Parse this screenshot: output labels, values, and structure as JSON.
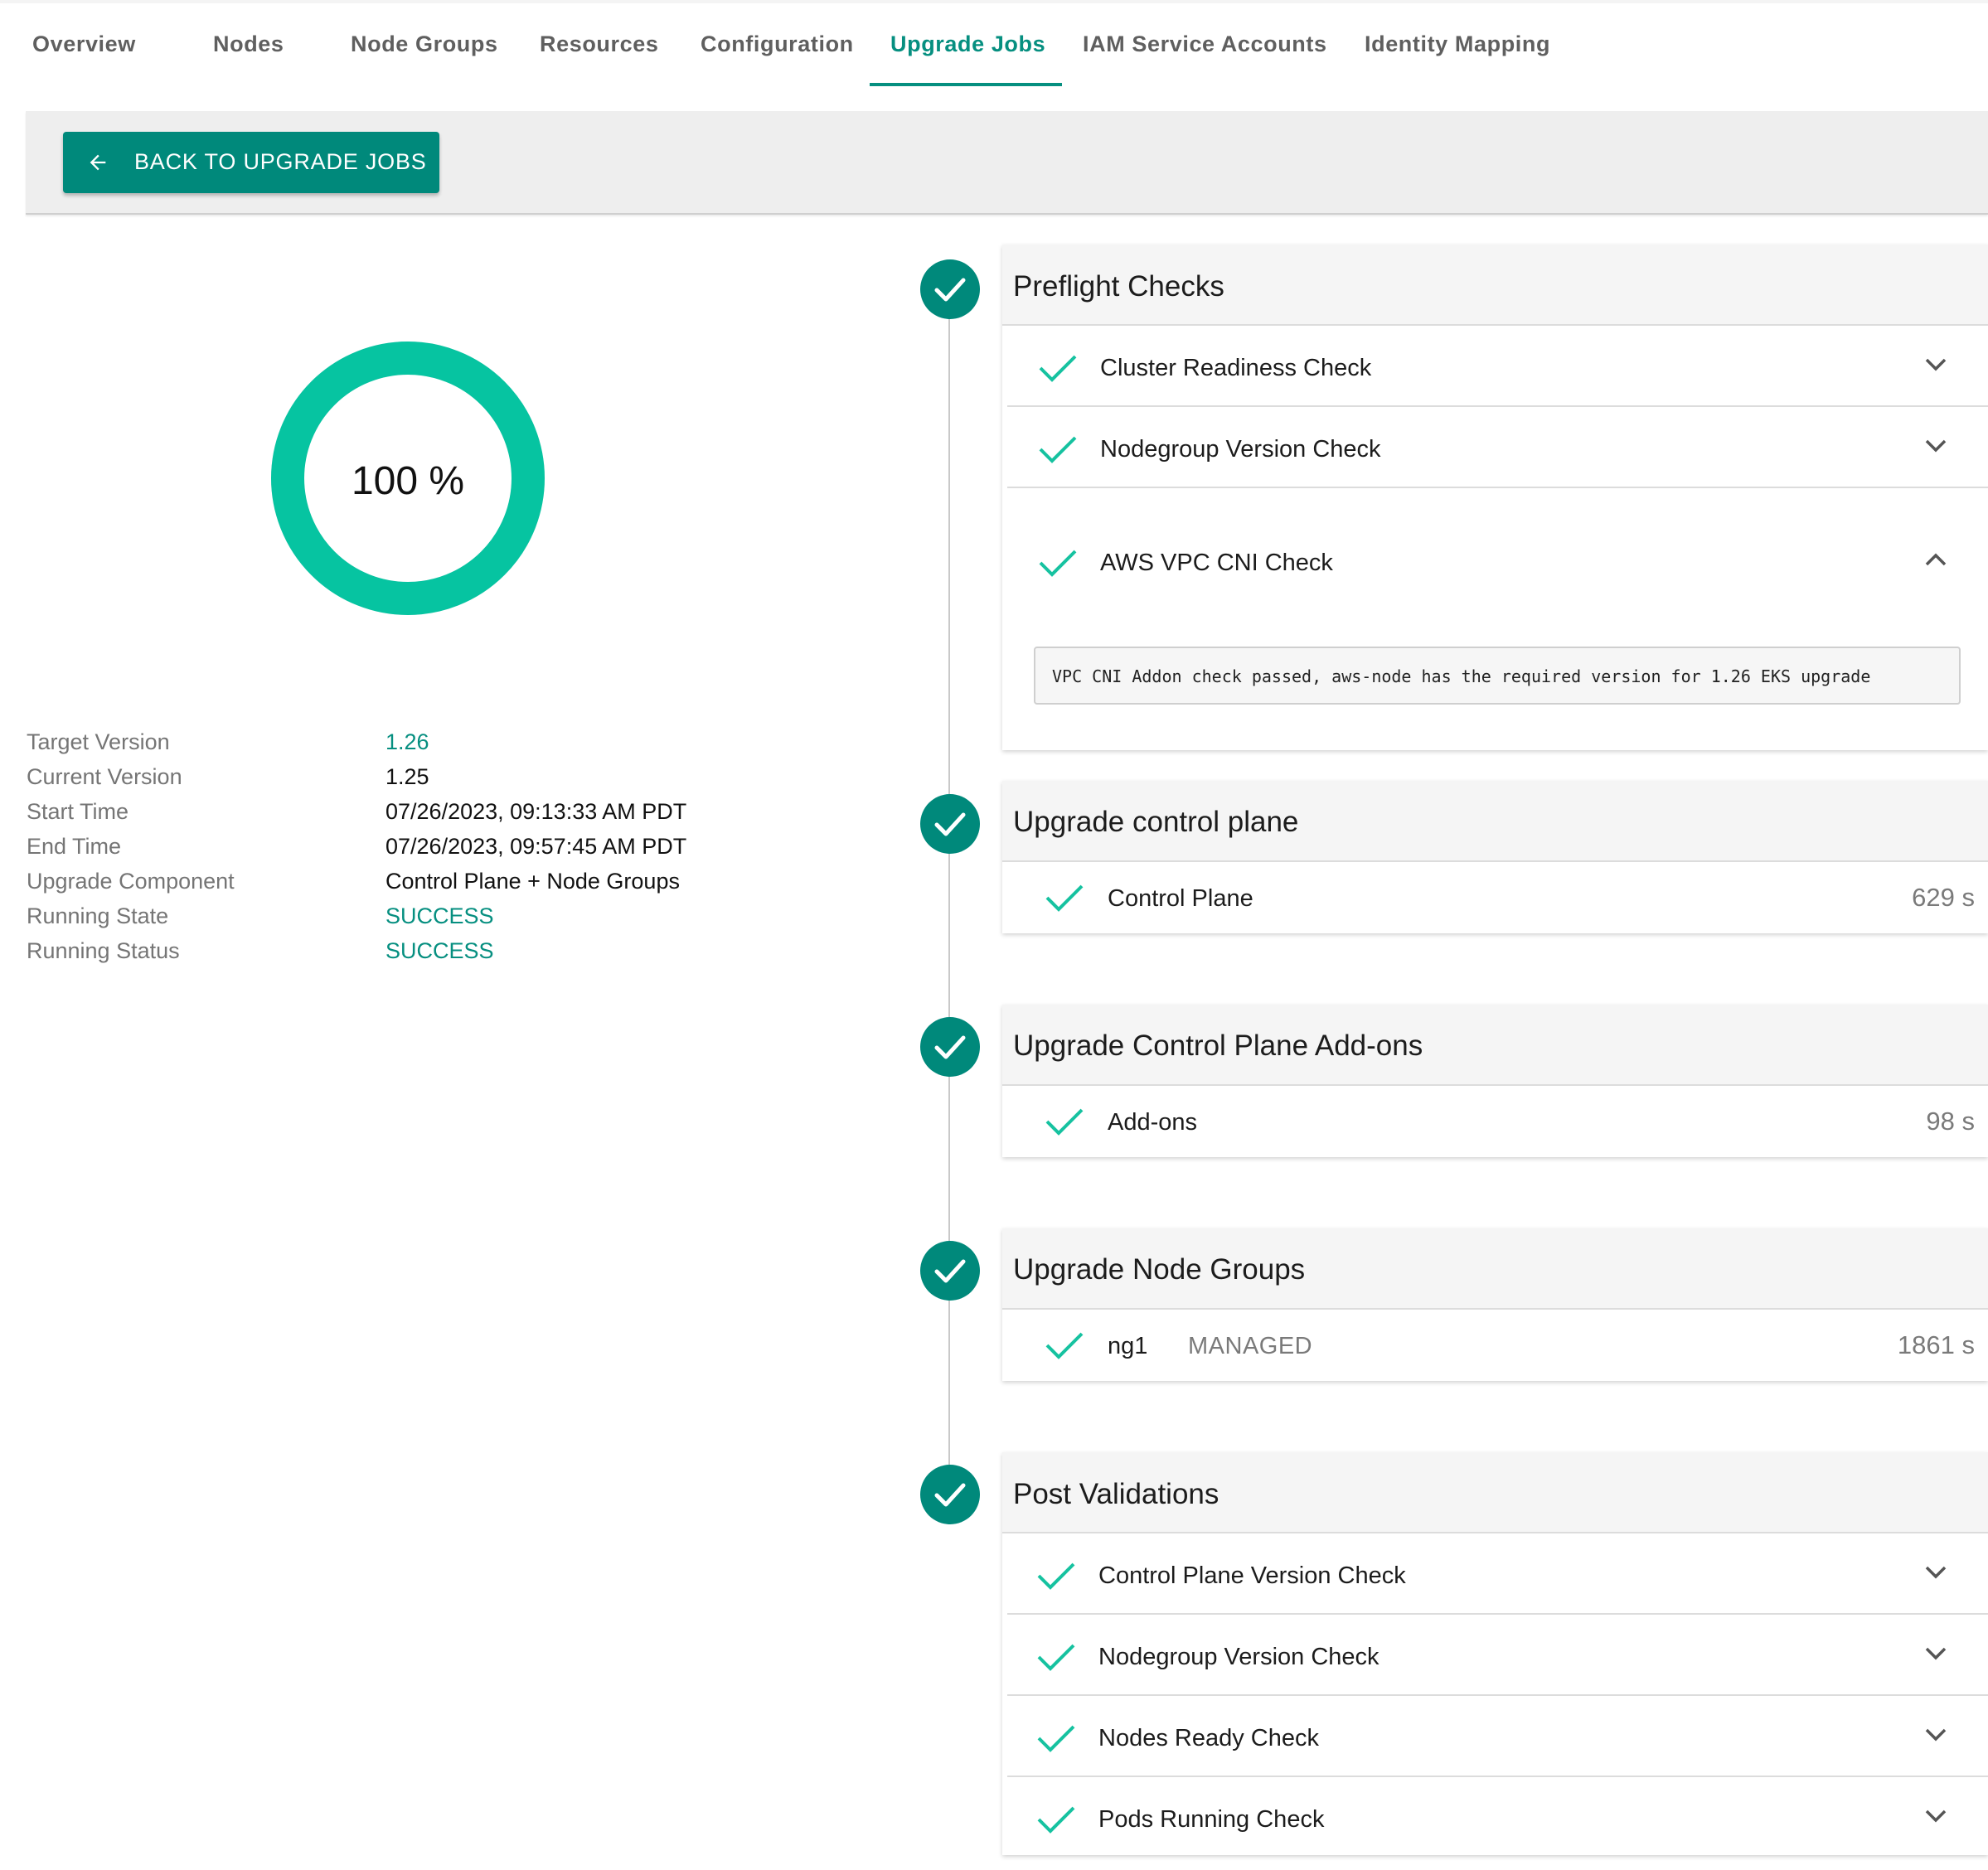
{
  "tabs": [
    {
      "label": "Overview"
    },
    {
      "label": "Nodes"
    },
    {
      "label": "Node Groups"
    },
    {
      "label": "Resources"
    },
    {
      "label": "Configuration"
    },
    {
      "label": "Upgrade Jobs",
      "active": true
    },
    {
      "label": "IAM Service Accounts"
    },
    {
      "label": "Identity Mapping"
    }
  ],
  "toolbar": {
    "back_label": "BACK TO UPGRADE JOBS"
  },
  "progress": {
    "percent": 100,
    "label": "100 %"
  },
  "info": [
    {
      "label": "Target Version",
      "value": "1.26"
    },
    {
      "label": "Current Version",
      "value": "1.25"
    },
    {
      "label": "Start Time",
      "value": "07/26/2023, 09:13:33 AM PDT"
    },
    {
      "label": "End Time",
      "value": "07/26/2023, 09:57:45 AM PDT"
    },
    {
      "label": "Upgrade Component",
      "value": "Control Plane + Node Groups"
    },
    {
      "label": "Running State",
      "value": "SUCCESS"
    },
    {
      "label": "Running Status",
      "value": "SUCCESS"
    }
  ],
  "steps": {
    "preflight": {
      "title": "Preflight Checks",
      "checks": [
        {
          "label": "Cluster Readiness Check"
        },
        {
          "label": "Nodegroup Version Check"
        },
        {
          "label": "AWS VPC CNI Check",
          "detail": "VPC CNI Addon check passed, aws-node has the required version for 1.26 EKS upgrade"
        }
      ]
    },
    "control_plane": {
      "title": "Upgrade control plane",
      "task": {
        "label": "Control Plane",
        "duration": "629 s"
      }
    },
    "addons": {
      "title": "Upgrade Control Plane Add-ons",
      "task": {
        "label": "Add-ons",
        "duration": "98 s"
      }
    },
    "node_groups": {
      "title": "Upgrade Node Groups",
      "task": {
        "label": "ng1",
        "type": "MANAGED",
        "duration": "1861 s"
      }
    },
    "post": {
      "title": "Post Validations",
      "checks": [
        {
          "label": "Control Plane Version Check"
        },
        {
          "label": "Nodegroup Version Check"
        },
        {
          "label": "Nodes Ready Check"
        },
        {
          "label": "Pods Running Check"
        }
      ]
    }
  },
  "colors": {
    "accent": "#00897b",
    "tab_active": "#068f80",
    "ring": "#06c4a1",
    "check": "#16c2a0"
  },
  "icons": {
    "back": "arrow-left-icon",
    "step": "check-circle-icon",
    "row": "check-icon",
    "expand": "chevron-down-icon",
    "collapse": "chevron-up-icon"
  }
}
